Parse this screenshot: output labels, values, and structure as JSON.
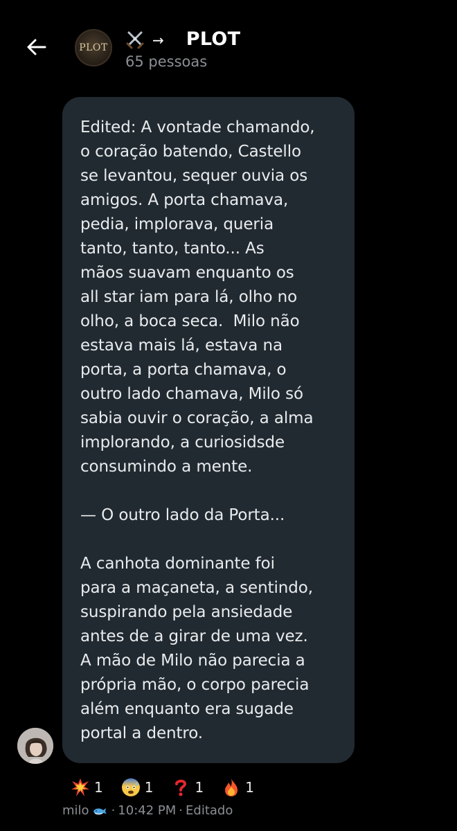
{
  "header": {
    "title": "PLOT",
    "subtitle": "65 pessoas",
    "avatar_text": "PLOT",
    "title_prefix_arrow": "→",
    "back_icon": "back-arrow-icon",
    "title_emoji_icon": "crossed-swords-icon"
  },
  "message": {
    "paragraphs": [
      "Edited: A vontade chamando,\no coração batendo, Castello\nse levantou, sequer ouvia os\namigos. A porta chamava,\npedia, implorava, queria\ntanto, tanto, tanto... As\nmãos suavam enquanto os\nall star iam para lá, olho no\nolho, a boca seca.  Milo não\nestava mais lá, estava na\nporta, a porta chamava, o\noutro lado chamava, Milo só\nsabia ouvir o coração, a alma\nimplorando, a curiosidsde\nconsumindo a mente.",
      "— O outro lado da Porta...",
      "A canhota dominante foi\npara a maçaneta, a sentindo,\nsuspirando pela ansiedade\nantes de a girar de uma vez.\nA mão de Milo não parecia a\nprópria mão, o corpo parecia\nalém enquanto era sugade\nportal a dentro."
    ]
  },
  "reactions": [
    {
      "icon": "collision-icon",
      "count": "1"
    },
    {
      "icon": "anxious-face-icon",
      "count": "1"
    },
    {
      "icon": "question-mark-icon",
      "count": "1"
    },
    {
      "icon": "fire-icon",
      "count": "1"
    }
  ],
  "meta": {
    "sender": "milo",
    "sender_emoji_icon": "whale-icon",
    "separator": "·",
    "time": "10:42 PM",
    "status": "Editado"
  },
  "colors": {
    "background": "#000000",
    "bubble": "#222a31",
    "text": "#e9ecee",
    "muted": "#8b8f94"
  }
}
